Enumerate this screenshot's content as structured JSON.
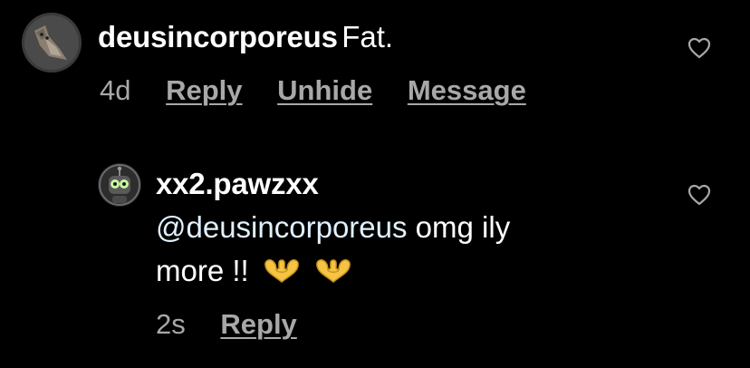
{
  "comments": [
    {
      "username": "deusincorporeus",
      "text": "Fat.",
      "time": "4d",
      "actions": [
        "Reply",
        "Unhide",
        "Message"
      ],
      "avatar_icon": "cat-avatar-icon",
      "like_icon": "heart-outline-icon"
    },
    {
      "username": "xx2.pawzxx",
      "mention": "@deusincorporeus",
      "text_line1_rest": " omg ily",
      "text_line2": "more !!",
      "emojis": [
        "heart-hands-emoji",
        "heart-hands-emoji"
      ],
      "time": "2s",
      "actions": [
        "Reply"
      ],
      "avatar_icon": "cartoon-robot-avatar-icon",
      "like_icon": "heart-outline-icon"
    }
  ],
  "colors": {
    "background": "#000000",
    "text": "#ffffff",
    "secondary": "#a8a8a8",
    "mention": "#e0f1ff",
    "emoji": "#f5c443"
  }
}
